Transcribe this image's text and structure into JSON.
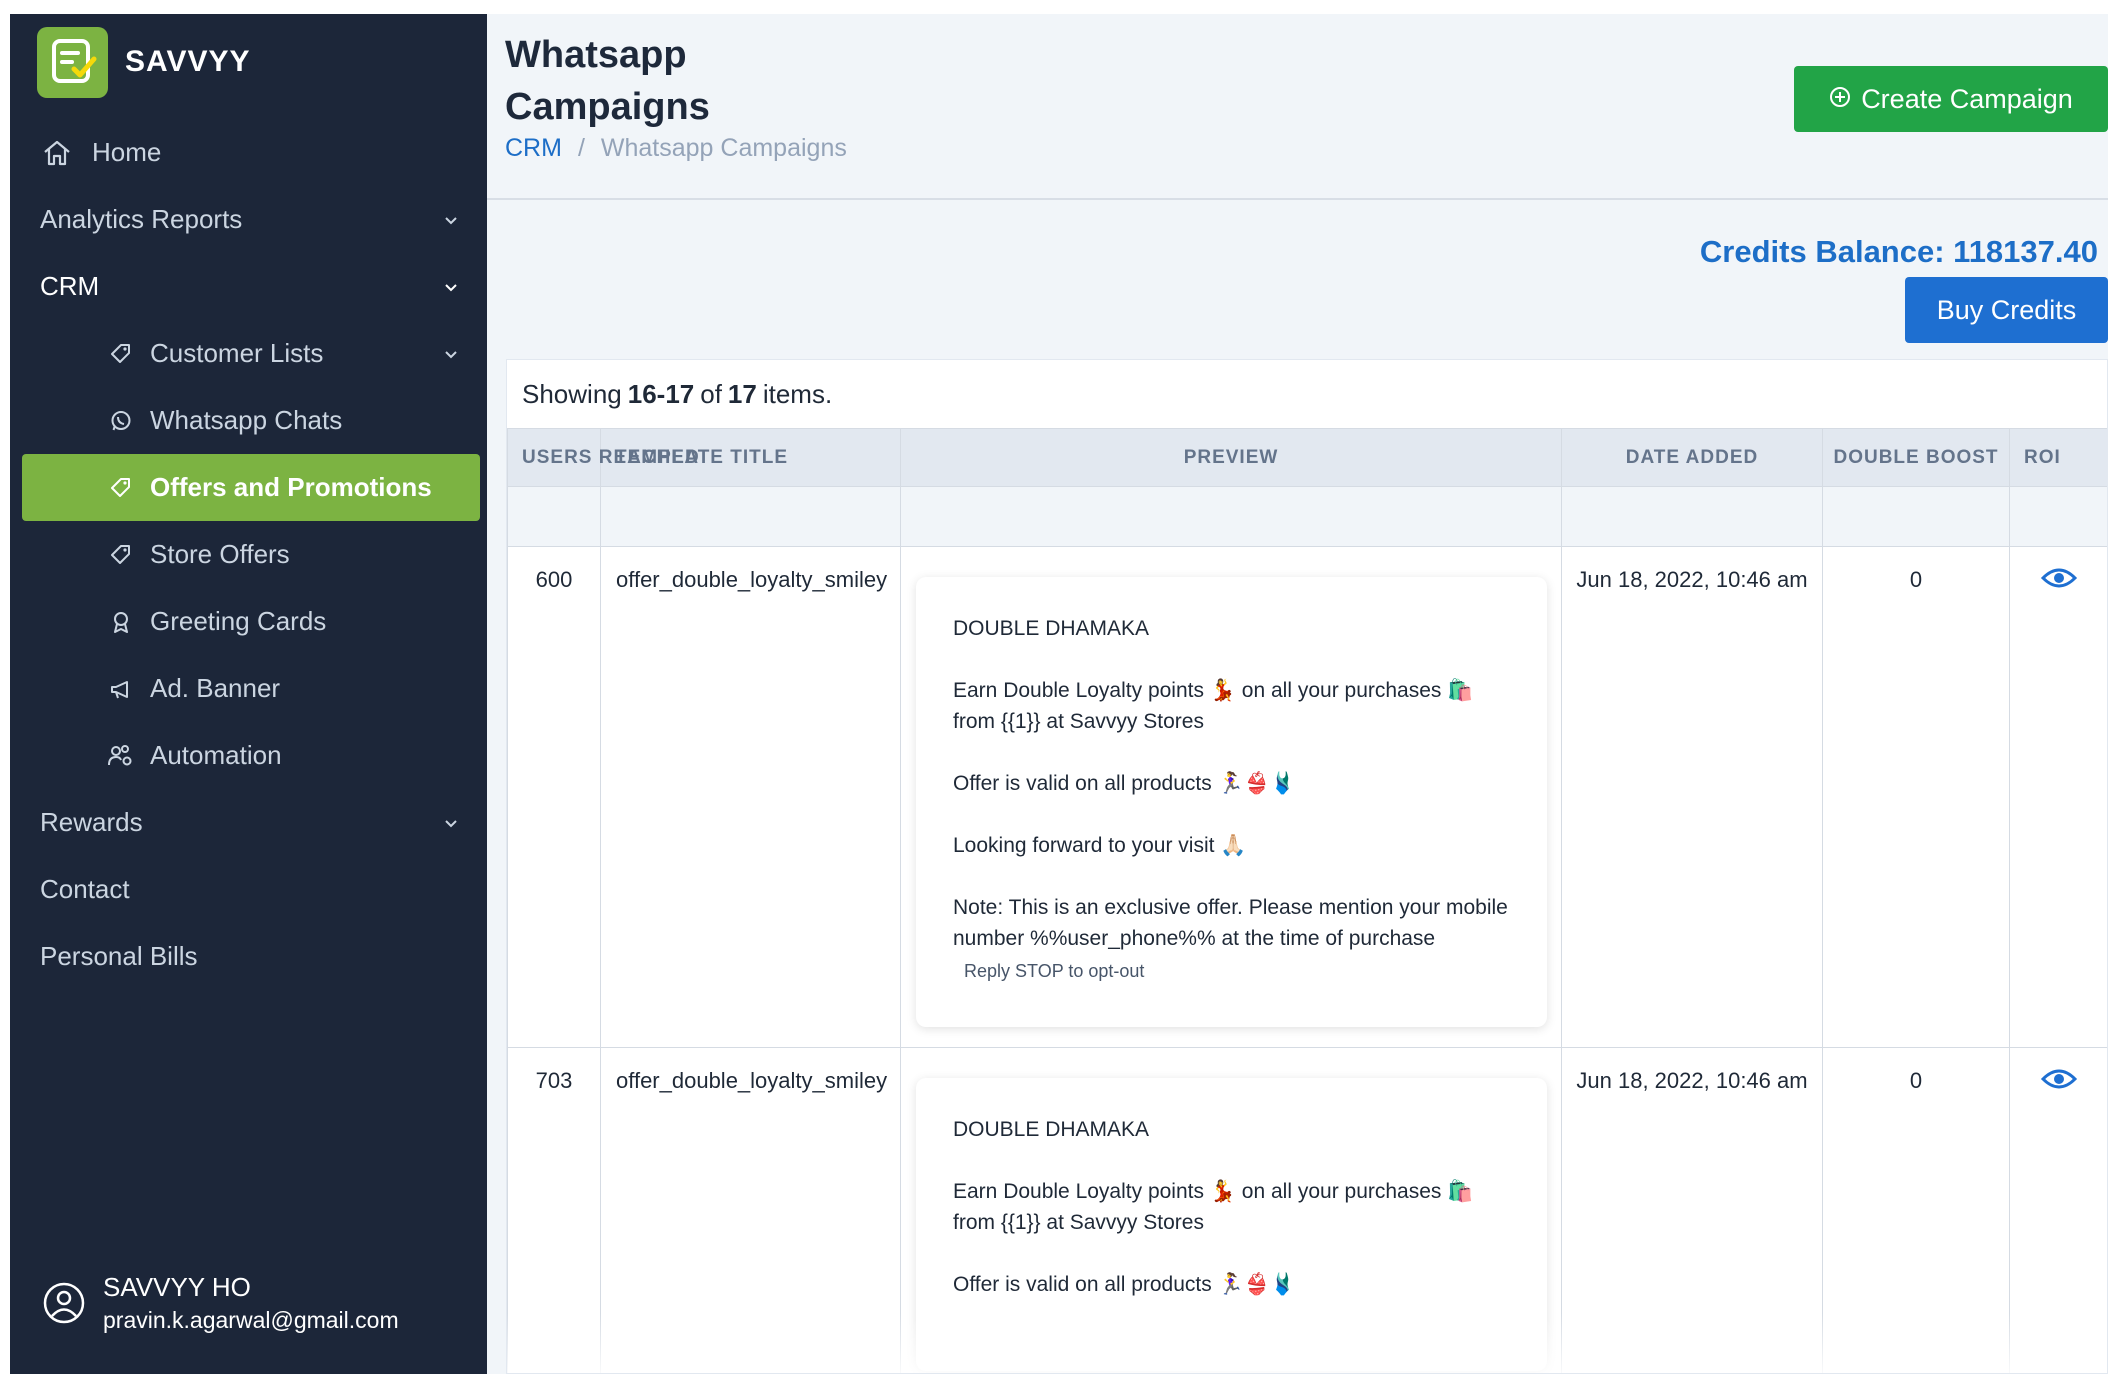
{
  "brand": {
    "name": "SAVVYY"
  },
  "sidebar": {
    "items": [
      {
        "label": "Home",
        "icon": "home-icon"
      },
      {
        "label": "Analytics Reports"
      },
      {
        "label": "CRM"
      },
      {
        "label": "Customer Lists",
        "icon": "tag-icon"
      },
      {
        "label": "Whatsapp Chats",
        "icon": "whatsapp-icon"
      },
      {
        "label": "Offers and Promotions",
        "icon": "tag-icon",
        "active": true
      },
      {
        "label": "Store Offers",
        "icon": "tag-icon"
      },
      {
        "label": "Greeting Cards",
        "icon": "award-icon"
      },
      {
        "label": "Ad. Banner",
        "icon": "megaphone-icon"
      },
      {
        "label": "Automation",
        "icon": "users-gear-icon"
      },
      {
        "label": "Rewards"
      },
      {
        "label": "Contact"
      },
      {
        "label": "Personal Bills"
      }
    ]
  },
  "user": {
    "name": "SAVVYY HO",
    "email": "pravin.k.agarwal@gmail.com"
  },
  "header": {
    "title": "Whatsapp Campaigns",
    "breadcrumb": {
      "root": "CRM",
      "separator": "/",
      "current": "Whatsapp Campaigns"
    },
    "create_label": "Create Campaign"
  },
  "credits": {
    "label": "Credits Balance: 118137.40",
    "buy_label": "Buy Credits"
  },
  "summary": {
    "prefix": "Showing",
    "range": "16-17",
    "middle": "of",
    "total": "17",
    "suffix": "items."
  },
  "table": {
    "columns": [
      "USERS REACHED",
      "TEMPLATE TITLE",
      "PREVIEW",
      "DATE ADDED",
      "DOUBLE BOOST",
      "ROI"
    ],
    "rows": [
      {
        "users_reached": "600",
        "template_title": "offer_double_loyalty_smiley",
        "date_added": "Jun 18, 2022, 10:46 am",
        "double_boost": "0",
        "preview": {
          "heading": "DOUBLE DHAMAKA",
          "line1": "Earn Double Loyalty points 💃 on all your purchases 🛍️ from {{1}} at Savvyy Stores",
          "line2": "Offer is valid on all products 🏃‍♀️👙🩱",
          "line3": "Looking forward to your visit 🙏🏻",
          "line4": "Note: This is an exclusive offer. Please mention your mobile number %%user_phone%% at the time of purchase",
          "footer": "Reply STOP to opt-out"
        }
      },
      {
        "users_reached": "703",
        "template_title": "offer_double_loyalty_smiley",
        "date_added": "Jun 18, 2022, 10:46 am",
        "double_boost": "0",
        "preview": {
          "heading": "DOUBLE DHAMAKA",
          "line1": "Earn Double Loyalty points 💃 on all your purchases 🛍️ from {{1}} at Savvyy Stores",
          "line2": "Offer is valid on all products 🏃‍♀️👙🩱"
        }
      }
    ]
  },
  "colors": {
    "sidebar": "#1c2639",
    "accent_green": "#7cb342",
    "create_button": "#22a447",
    "primary_blue": "#1e6fd1"
  }
}
